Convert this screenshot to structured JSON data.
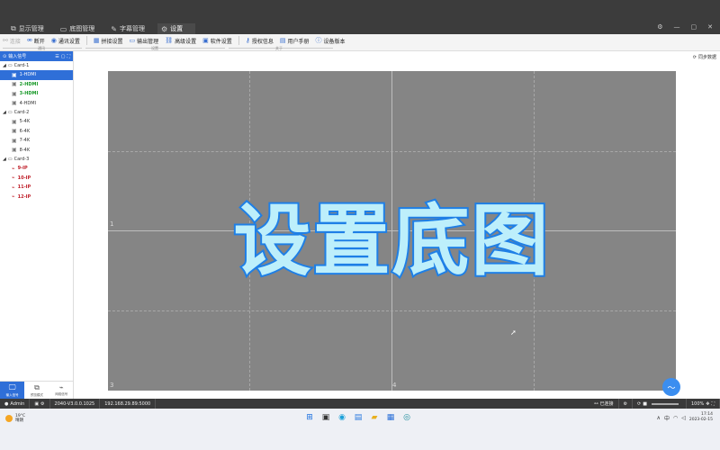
{
  "titlebar": {
    "tabs": [
      {
        "label": "显示管理",
        "icon": "display-icon"
      },
      {
        "label": "底图管理",
        "icon": "monitor-icon"
      },
      {
        "label": "字幕管理",
        "icon": "pen-icon"
      },
      {
        "label": "设置",
        "icon": "gear-icon"
      }
    ],
    "active_tab": 3
  },
  "toolbar": {
    "connect": "连接",
    "disconnect": "断开",
    "comm_settings": "通讯设置",
    "splice_settings": "拼接设置",
    "output_mgmt": "输出管理",
    "advanced_settings": "高级设置",
    "software_settings": "软件设置",
    "license_info": "授权信息",
    "user_manual": "用户手册",
    "device_version": "设备版本",
    "group_comm": "通讯",
    "group_settings": "设置",
    "group_about": "关于"
  },
  "sidebar": {
    "header": "输入信号",
    "cards": [
      {
        "name": "Card-1",
        "items": [
          {
            "label": "1-HDMI",
            "style": "sel"
          },
          {
            "label": "2-HDMI",
            "style": "green"
          },
          {
            "label": "3-HDMI",
            "style": "green"
          },
          {
            "label": "4-HDMI",
            "style": "normal"
          }
        ]
      },
      {
        "name": "Card-2",
        "items": [
          {
            "label": "5-4K",
            "style": "normal"
          },
          {
            "label": "6-4K",
            "style": "normal"
          },
          {
            "label": "7-4K",
            "style": "normal"
          },
          {
            "label": "8-4K",
            "style": "normal"
          }
        ]
      },
      {
        "name": "Card-3",
        "items": [
          {
            "label": "9-IP",
            "style": "red"
          },
          {
            "label": "10-IP",
            "style": "red"
          },
          {
            "label": "11-IP",
            "style": "red"
          },
          {
            "label": "12-IP",
            "style": "red"
          }
        ]
      }
    ],
    "bottom": [
      "输入信号",
      "预览模式",
      "网络信号"
    ]
  },
  "main": {
    "sync": "同步数据",
    "overlay_text": "设置底图",
    "quadrants": [
      "1",
      "3",
      "4"
    ]
  },
  "status": {
    "user": "Admin",
    "version": "2040-V3.0.0.1025",
    "ip": "192.168.29.89:5000",
    "connected": "已连接",
    "zoom": "100%"
  },
  "taskbar": {
    "weather_temp": "19°C",
    "weather_desc": "晴朗",
    "ime": "中",
    "time": "17:14",
    "date": "2023-02-15"
  },
  "colors": {
    "accent": "#2f6fd8",
    "canvas": "#858585",
    "overlay_fill": "#bdeffb",
    "overlay_stroke": "#1e7fe6"
  }
}
